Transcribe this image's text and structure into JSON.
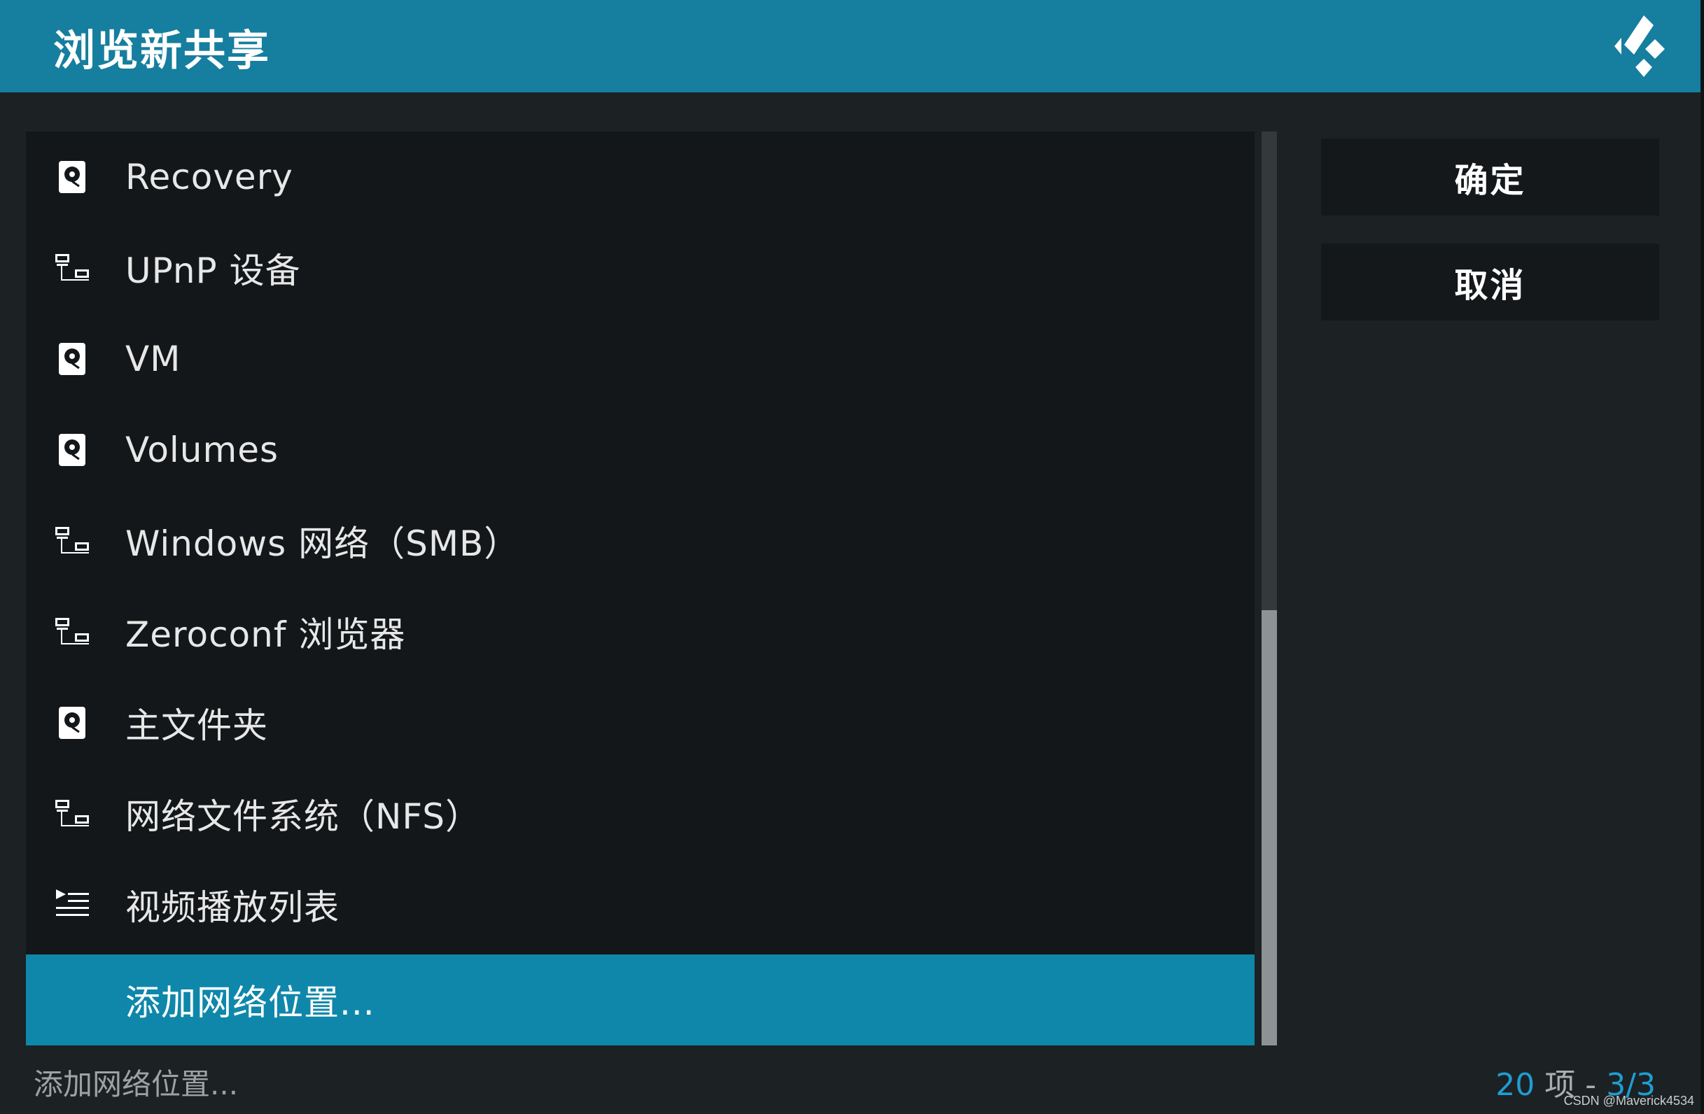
{
  "header": {
    "title": "浏览新共享",
    "logo_icon": "kodi-logo-icon"
  },
  "list": {
    "items": [
      {
        "label": "Recovery",
        "icon": "hard-drive-icon"
      },
      {
        "label": "UPnP 设备",
        "icon": "network-icon"
      },
      {
        "label": "VM",
        "icon": "hard-drive-icon"
      },
      {
        "label": "Volumes",
        "icon": "hard-drive-icon"
      },
      {
        "label": "Windows 网络（SMB）",
        "icon": "network-icon"
      },
      {
        "label": "Zeroconf 浏览器",
        "icon": "network-icon"
      },
      {
        "label": "主文件夹",
        "icon": "hard-drive-icon"
      },
      {
        "label": "网络文件系统（NFS）",
        "icon": "network-icon"
      },
      {
        "label": "视频播放列表",
        "icon": "playlist-icon"
      },
      {
        "label": "添加网络位置...",
        "icon": ""
      }
    ],
    "selected_index": 9
  },
  "buttons": {
    "ok_label": "确定",
    "cancel_label": "取消"
  },
  "footer": {
    "selected_label": "添加网络位置...",
    "count": "20",
    "count_unit": "项",
    "separator": "-",
    "page": "3/3"
  },
  "watermark": "CSDN @Maverick4534",
  "colors": {
    "header": "#167e9e",
    "selected": "#0f87aa",
    "accent": "#1f9dd1"
  }
}
